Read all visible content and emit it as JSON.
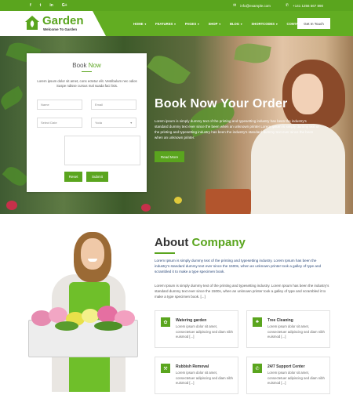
{
  "topbar": {
    "social": [
      "f",
      "t",
      "in",
      "G+"
    ],
    "email": "info@example.com",
    "phone": "+141 1256 567 890"
  },
  "brand": {
    "name": "Garden",
    "tagline": "Welcome To Garden"
  },
  "nav": {
    "items": [
      {
        "label": "HOME",
        "dropdown": true
      },
      {
        "label": "FEATURES",
        "dropdown": true
      },
      {
        "label": "PAGES",
        "dropdown": true
      },
      {
        "label": "SHOP",
        "dropdown": true
      },
      {
        "label": "BLOG",
        "dropdown": true
      },
      {
        "label": "SHORTCODES",
        "dropdown": true
      },
      {
        "label": "CONTACT US",
        "dropdown": true
      }
    ],
    "cta": "Get In Touch"
  },
  "booking": {
    "title_a": "Book",
    "title_b": "Now",
    "description": "Lorem ipsum dolor sit amet, cons ectetur elit. Vestibulum nec odios Suspe ndisse cursus mal suada faci lisis.",
    "name_placeholder": "Name",
    "email_placeholder": "Email",
    "date_placeholder": "Select Date",
    "type_placeholder": "Yoda",
    "reset_label": "Reset",
    "submit_label": "Submit"
  },
  "hero": {
    "title": "Book Now Your Order",
    "body": "Lorem ipsum is simply dummy text of the printing and typesetting industry has been the industry's standard dummy text ever since the been when an unknown printer Lorem Ipsum is simply dummy text of the printing and typesetting industry has been the industry's standard dummy text ever since the been when an unknown printer.",
    "button": "Read More"
  },
  "about": {
    "title_a": "About",
    "title_b": "Company",
    "p1": "Lorem Ipsum is simply dummy text of the printing and typesetting industry. Lorem Ipsum has been the industry's standard dummy text ever since the 1500s, when an unknown printer took a galley of type and scrambled it to make a type specimen book.",
    "p2": "Lorem Ipsum is simply dummy text of the printing and typesetting industry. Lorem Ipsum has been the industry's standard dummy text ever since the 1500s, when an unknown printer took a galley of type and scrambled it to make a type specimen book. [...]",
    "services": [
      {
        "title": "Watering garden",
        "desc": "Lorem ipsum dolor sit amet, consectetuer adipiscing sed diam nibh euismod [...]",
        "icon": "watering-can-icon"
      },
      {
        "title": "Tree Cleaning",
        "desc": "Lorem ipsum dolor sit amet, consectetuer adipiscing sed diam nibh euismod [...]",
        "icon": "tree-icon"
      },
      {
        "title": "Rubbish Removal",
        "desc": "Lorem ipsum dolor sit amet, consectetuer adipiscing sed diam nibh euismod [...]",
        "icon": "rake-icon"
      },
      {
        "title": "24/7 Support Center",
        "desc": "Lorem ipsum dolor sit amet, consectetuer adipiscing sed diam nibh euismod [...]",
        "icon": "phone-icon"
      }
    ]
  },
  "colors": {
    "accent": "#5aa51e",
    "nav_bg": "#62ad22"
  }
}
